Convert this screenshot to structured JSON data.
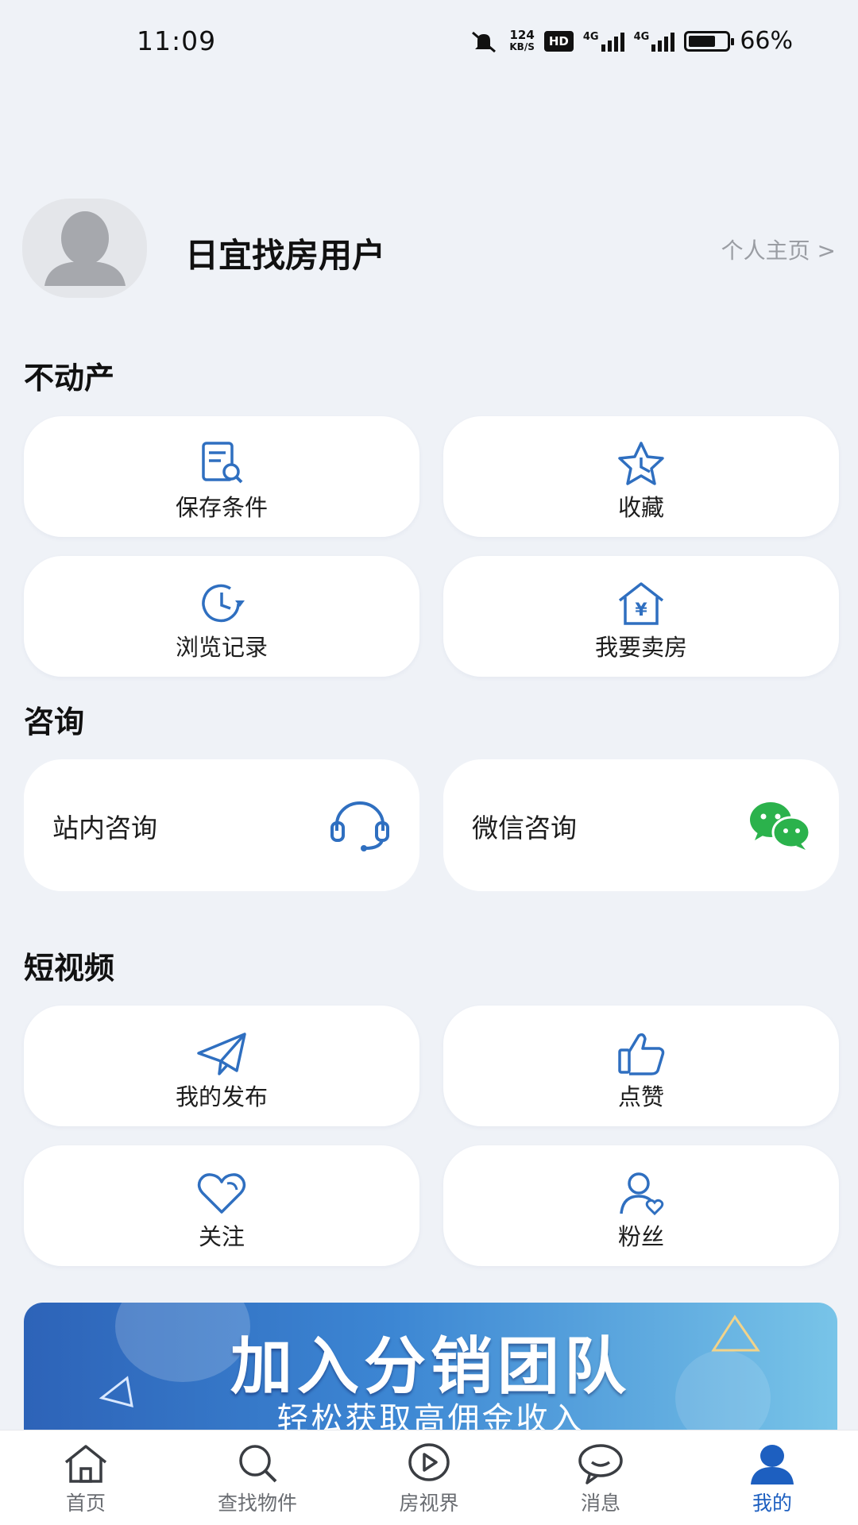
{
  "status_bar": {
    "time": "11:09",
    "net_speed_value": "124",
    "net_speed_unit": "KB/S",
    "hd": "HD",
    "sig1": "4G",
    "sig2": "4G",
    "battery": "66%"
  },
  "profile": {
    "username": "日宜找房用户",
    "profile_link": "个人主页 >"
  },
  "sections": {
    "real_estate": {
      "title": "不动产",
      "items": [
        {
          "label": "保存条件",
          "icon": "saved-search-icon"
        },
        {
          "label": "收藏",
          "icon": "star-icon"
        },
        {
          "label": "浏览记录",
          "icon": "history-icon"
        },
        {
          "label": "我要卖房",
          "icon": "sell-house-icon"
        }
      ]
    },
    "consult": {
      "title": "咨询",
      "items": [
        {
          "label": "站内咨询",
          "icon": "headset-icon"
        },
        {
          "label": "微信咨询",
          "icon": "wechat-icon"
        }
      ]
    },
    "short_video": {
      "title": "短视频",
      "items": [
        {
          "label": "我的发布",
          "icon": "paper-plane-icon"
        },
        {
          "label": "点赞",
          "icon": "thumbs-up-icon"
        },
        {
          "label": "关注",
          "icon": "heart-icon"
        },
        {
          "label": "粉丝",
          "icon": "follower-icon"
        }
      ]
    }
  },
  "banner": {
    "title": "加入分销团队",
    "subtitle": "轻松获取高佣金收入"
  },
  "bottom_nav": {
    "active_index": 4,
    "items": [
      {
        "label": "首页",
        "icon": "home-icon"
      },
      {
        "label": "查找物件",
        "icon": "search-icon"
      },
      {
        "label": "房视界",
        "icon": "play-icon"
      },
      {
        "label": "消息",
        "icon": "message-icon"
      },
      {
        "label": "我的",
        "icon": "user-icon"
      }
    ]
  },
  "colors": {
    "background": "#eff2f7",
    "icon_blue": "#2f6fc0",
    "nav_active": "#1d5fc0",
    "wechat_green": "#2bb24c"
  }
}
